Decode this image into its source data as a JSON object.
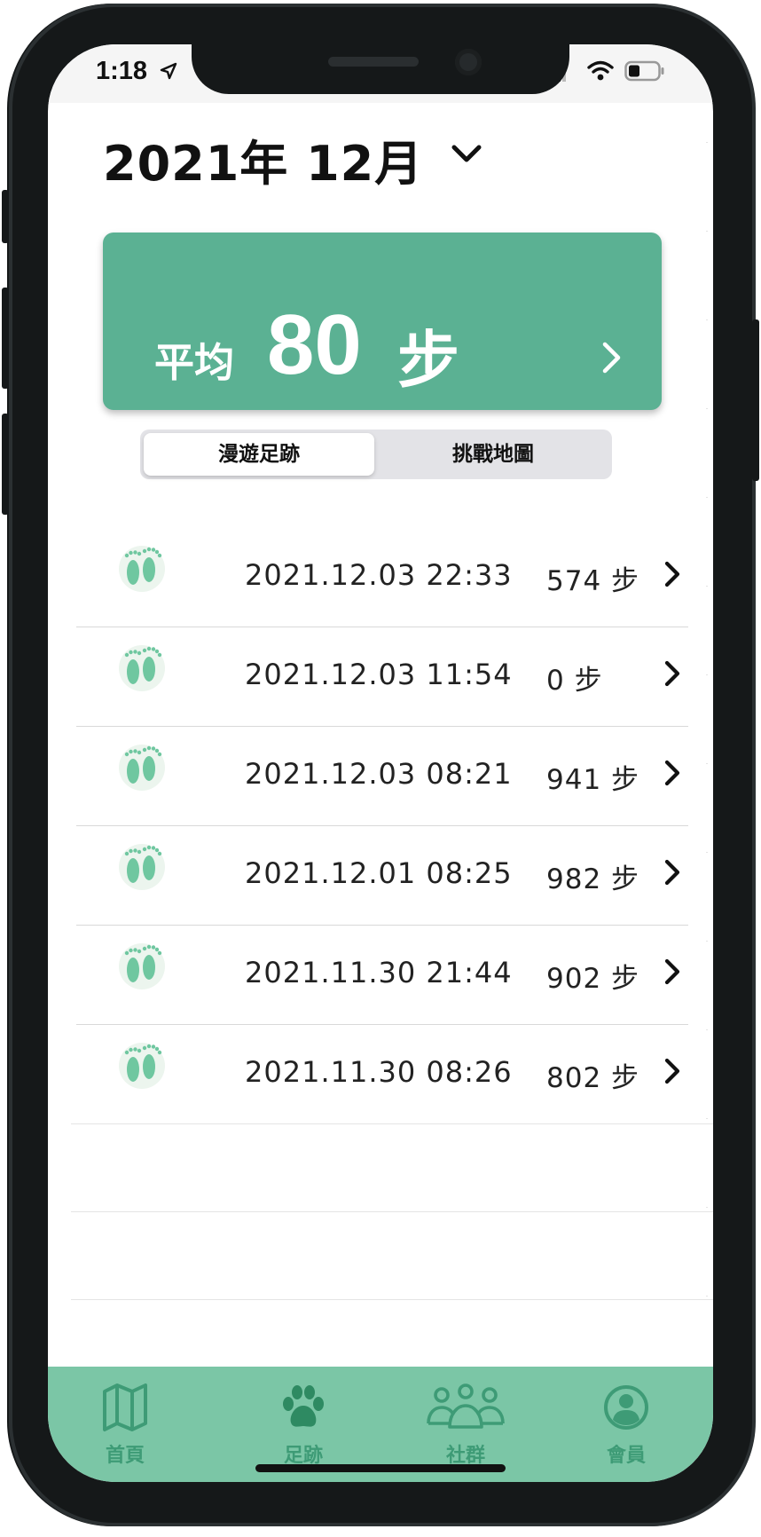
{
  "status_bar": {
    "time": "1:18"
  },
  "header": {
    "month_title": "2021年 12月"
  },
  "summary": {
    "label": "平均",
    "value": "80",
    "unit": "步"
  },
  "segments": [
    {
      "label": "漫遊足跡",
      "selected": true
    },
    {
      "label": "挑戰地圖",
      "selected": false
    }
  ],
  "records": [
    {
      "datetime": "2021.12.03 22:33",
      "steps": "574 步"
    },
    {
      "datetime": "2021.12.03 11:54",
      "steps": "0 步"
    },
    {
      "datetime": "2021.12.03 08:21",
      "steps": "941 步"
    },
    {
      "datetime": "2021.12.01 08:25",
      "steps": "982 步"
    },
    {
      "datetime": "2021.11.30 21:44",
      "steps": "902 步"
    },
    {
      "datetime": "2021.11.30 08:26",
      "steps": "802 步"
    }
  ],
  "tabbar": [
    {
      "label": "首頁",
      "icon": "map-icon"
    },
    {
      "label": "足跡",
      "icon": "paw-icon"
    },
    {
      "label": "社群",
      "icon": "group-icon"
    },
    {
      "label": "會員",
      "icon": "profile-icon"
    }
  ],
  "colors": {
    "accent": "#5bb193",
    "tabbar": "#7bc6a6",
    "tab_icon": "#3e9b76"
  }
}
